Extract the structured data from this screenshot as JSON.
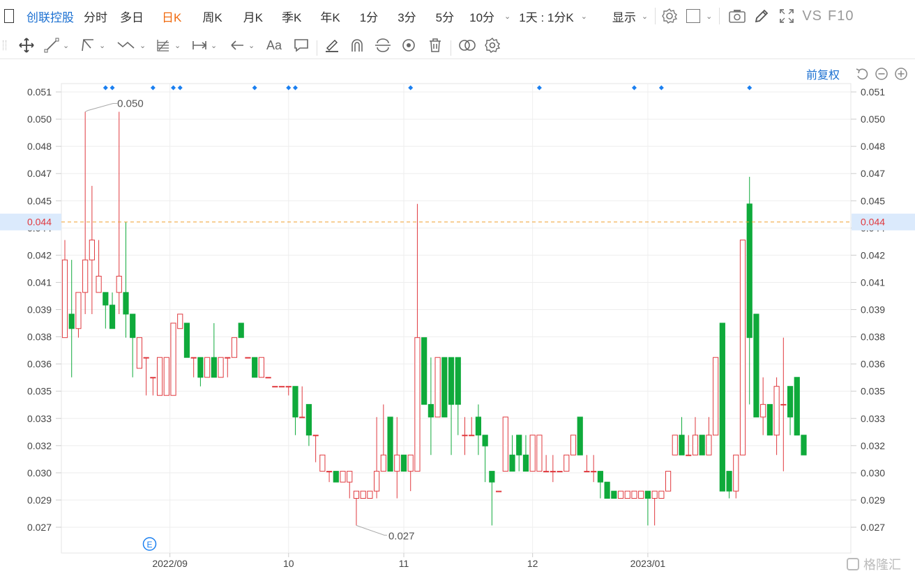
{
  "toolbar": {
    "stock_name": "创联控股",
    "tabs": [
      {
        "label": "分时",
        "active": false
      },
      {
        "label": "多日",
        "active": false
      },
      {
        "label": "日K",
        "active": true
      },
      {
        "label": "周K",
        "active": false
      },
      {
        "label": "月K",
        "active": false
      },
      {
        "label": "季K",
        "active": false
      },
      {
        "label": "年K",
        "active": false
      },
      {
        "label": "1分",
        "active": false
      },
      {
        "label": "3分",
        "active": false
      },
      {
        "label": "5分",
        "active": false
      },
      {
        "label": "10分",
        "active": false
      }
    ],
    "period_select": "1天 : 1分K",
    "display_label": "显示",
    "vs_label": "VS",
    "f10_label": "F10"
  },
  "chart_header": {
    "adjust_label": "前复权"
  },
  "watermark": "格隆汇",
  "colors": {
    "up": "#e0393e",
    "down": "#0faa3b",
    "accent": "#1a6fd1",
    "active_tab": "#f06a0f",
    "current_price_line": "#f0a030",
    "grid": "#eeeeee"
  },
  "chart_data": {
    "type": "candlestick",
    "y_ticks": [
      "0.051",
      "0.050",
      "0.048",
      "0.047",
      "0.045",
      "0.044",
      "0.042",
      "0.041",
      "0.039",
      "0.038",
      "0.036",
      "0.035",
      "0.033",
      "0.032",
      "0.030",
      "0.029",
      "0.027"
    ],
    "ylim": [
      0.0262,
      0.0519
    ],
    "x_labels": [
      {
        "label": "2022/09",
        "index": 15.5
      },
      {
        "label": "10",
        "index": 33
      },
      {
        "label": "11",
        "index": 50
      },
      {
        "label": "12",
        "index": 69
      },
      {
        "label": "2023/01",
        "index": 86
      }
    ],
    "current_price": "0.044",
    "current_value": 0.0441,
    "high_label": "0.050",
    "low_label": "0.027",
    "event_marker": "E",
    "event_index": 12.5,
    "diamond_indices": [
      6,
      7,
      13,
      16,
      17,
      28,
      33,
      34,
      51,
      70,
      84,
      88,
      101
    ],
    "candles": [
      [
        0.0377,
        0.042,
        0.0431,
        0.0377
      ],
      [
        0.039,
        0.0382,
        0.042,
        0.0355
      ],
      [
        0.0382,
        0.0402,
        0.0402,
        0.0377
      ],
      [
        0.0402,
        0.042,
        0.0502,
        0.039
      ],
      [
        0.042,
        0.0431,
        0.0461,
        0.039
      ],
      [
        0.0402,
        0.0411,
        0.0431,
        0.0402
      ],
      [
        0.0402,
        0.0395,
        0.0402,
        0.0382
      ],
      [
        0.0395,
        0.0382,
        0.0402,
        0.0382
      ],
      [
        0.0402,
        0.0411,
        0.0502,
        0.039
      ],
      [
        0.0402,
        0.039,
        0.0441,
        0.0377
      ],
      [
        0.039,
        0.0377,
        0.039,
        0.0355
      ],
      [
        0.036,
        0.0377,
        0.0377,
        0.036
      ],
      [
        0.0366,
        0.0366,
        0.0366,
        0.0345
      ],
      [
        0.0355,
        0.0355,
        0.0355,
        0.0345
      ],
      [
        0.0345,
        0.0366,
        0.0366,
        0.0345
      ],
      [
        0.0345,
        0.0366,
        0.0366,
        0.0345
      ],
      [
        0.0345,
        0.0385,
        0.0385,
        0.0345
      ],
      [
        0.0382,
        0.039,
        0.039,
        0.0382
      ],
      [
        0.0385,
        0.0366,
        0.0385,
        0.0366
      ],
      [
        0.0366,
        0.0366,
        0.0366,
        0.0355
      ],
      [
        0.0366,
        0.0355,
        0.0366,
        0.035
      ],
      [
        0.0355,
        0.0366,
        0.0366,
        0.0355
      ],
      [
        0.0366,
        0.0355,
        0.0385,
        0.0355
      ],
      [
        0.0355,
        0.0366,
        0.0366,
        0.0355
      ],
      [
        0.0366,
        0.0366,
        0.0366,
        0.0355
      ],
      [
        0.0366,
        0.0377,
        0.0377,
        0.0366
      ],
      [
        0.0385,
        0.0377,
        0.0385,
        0.0377
      ],
      [
        0.0366,
        0.0366,
        0.0366,
        0.0366
      ],
      [
        0.0366,
        0.0355,
        0.0366,
        0.0355
      ],
      [
        0.0355,
        0.0366,
        0.0366,
        0.0355
      ],
      [
        0.0355,
        0.0355,
        0.0355,
        0.0355
      ],
      [
        0.035,
        0.035,
        0.035,
        0.035
      ],
      [
        0.035,
        0.035,
        0.035,
        0.035
      ],
      [
        0.035,
        0.035,
        0.035,
        0.0345
      ],
      [
        0.035,
        0.0333,
        0.035,
        0.0323
      ],
      [
        0.0333,
        0.0333,
        0.035,
        0.0333
      ],
      [
        0.034,
        0.0323,
        0.034,
        0.0317
      ],
      [
        0.0323,
        0.0323,
        0.0323,
        0.0308
      ],
      [
        0.0303,
        0.0312,
        0.0312,
        0.0303
      ],
      [
        0.0303,
        0.0303,
        0.0303,
        0.0297
      ],
      [
        0.0303,
        0.0297,
        0.0303,
        0.0297
      ],
      [
        0.0297,
        0.0303,
        0.0303,
        0.0297
      ],
      [
        0.0297,
        0.0303,
        0.0303,
        0.0288
      ],
      [
        0.0288,
        0.0292,
        0.0292,
        0.0273
      ],
      [
        0.0288,
        0.0292,
        0.0292,
        0.0288
      ],
      [
        0.0288,
        0.0292,
        0.0292,
        0.0288
      ],
      [
        0.0292,
        0.0303,
        0.0333,
        0.0288
      ],
      [
        0.0303,
        0.0312,
        0.034,
        0.0303
      ],
      [
        0.0333,
        0.0303,
        0.0333,
        0.0303
      ],
      [
        0.0303,
        0.0312,
        0.0333,
        0.0288
      ],
      [
        0.0312,
        0.0303,
        0.0312,
        0.0303
      ],
      [
        0.0303,
        0.0312,
        0.0312,
        0.0292
      ],
      [
        0.0303,
        0.0377,
        0.0451,
        0.0303
      ],
      [
        0.0377,
        0.034,
        0.0377,
        0.034
      ],
      [
        0.034,
        0.0333,
        0.0366,
        0.0312
      ],
      [
        0.0333,
        0.0366,
        0.0366,
        0.0333
      ],
      [
        0.0366,
        0.0333,
        0.0366,
        0.0333
      ],
      [
        0.0366,
        0.034,
        0.0366,
        0.0312
      ],
      [
        0.0366,
        0.034,
        0.0366,
        0.0323
      ],
      [
        0.0323,
        0.0323,
        0.0333,
        0.0312
      ],
      [
        0.0323,
        0.0323,
        0.0333,
        0.0323
      ],
      [
        0.0333,
        0.0323,
        0.034,
        0.0312
      ],
      [
        0.0323,
        0.0317,
        0.0323,
        0.0297
      ],
      [
        0.0303,
        0.0297,
        0.0303,
        0.0273
      ],
      [
        0.0292,
        0.0292,
        0.0292,
        0.0292
      ],
      [
        0.0303,
        0.0333,
        0.0333,
        0.0303
      ],
      [
        0.0312,
        0.0303,
        0.0323,
        0.0303
      ],
      [
        0.0323,
        0.0312,
        0.0323,
        0.0303
      ],
      [
        0.0312,
        0.0303,
        0.0323,
        0.0303
      ],
      [
        0.0303,
        0.0323,
        0.0323,
        0.0303
      ],
      [
        0.0303,
        0.0323,
        0.0323,
        0.0303
      ],
      [
        0.0303,
        0.0303,
        0.0312,
        0.0303
      ],
      [
        0.0303,
        0.0303,
        0.0312,
        0.0297
      ],
      [
        0.0303,
        0.0303,
        0.0303,
        0.0303
      ],
      [
        0.0303,
        0.0312,
        0.0312,
        0.0303
      ],
      [
        0.0312,
        0.0323,
        0.0323,
        0.0312
      ],
      [
        0.0333,
        0.0312,
        0.0333,
        0.0312
      ],
      [
        0.0303,
        0.0303,
        0.0312,
        0.0303
      ],
      [
        0.0303,
        0.0303,
        0.0312,
        0.0297
      ],
      [
        0.0303,
        0.0297,
        0.0303,
        0.0288
      ],
      [
        0.0297,
        0.0288,
        0.0297,
        0.0288
      ],
      [
        0.0292,
        0.0288,
        0.0292,
        0.0288
      ],
      [
        0.0288,
        0.0292,
        0.0292,
        0.0288
      ],
      [
        0.0288,
        0.0292,
        0.0292,
        0.0288
      ],
      [
        0.0288,
        0.0292,
        0.0292,
        0.0288
      ],
      [
        0.0288,
        0.0292,
        0.0292,
        0.0288
      ],
      [
        0.0292,
        0.0288,
        0.0292,
        0.0273
      ],
      [
        0.0288,
        0.0292,
        0.0292,
        0.0273
      ],
      [
        0.0288,
        0.0292,
        0.0292,
        0.0288
      ],
      [
        0.0292,
        0.0303,
        0.0303,
        0.0292
      ],
      [
        0.0312,
        0.0323,
        0.0323,
        0.0312
      ],
      [
        0.0323,
        0.0312,
        0.0333,
        0.0312
      ],
      [
        0.0312,
        0.0312,
        0.0323,
        0.0312
      ],
      [
        0.0312,
        0.0323,
        0.0333,
        0.0312
      ],
      [
        0.0323,
        0.0312,
        0.0323,
        0.0312
      ],
      [
        0.0312,
        0.0323,
        0.0333,
        0.0312
      ],
      [
        0.0323,
        0.0366,
        0.0366,
        0.0323
      ],
      [
        0.0385,
        0.0292,
        0.0385,
        0.0292
      ],
      [
        0.0303,
        0.0292,
        0.0303,
        0.0288
      ],
      [
        0.0292,
        0.0312,
        0.0312,
        0.0288
      ],
      [
        0.0312,
        0.0431,
        0.0431,
        0.0312
      ],
      [
        0.0451,
        0.0377,
        0.0466,
        0.034
      ],
      [
        0.039,
        0.0333,
        0.039,
        0.0333
      ],
      [
        0.0333,
        0.034,
        0.0355,
        0.0323
      ],
      [
        0.034,
        0.0323,
        0.034,
        0.0323
      ],
      [
        0.0323,
        0.035,
        0.0355,
        0.0312
      ],
      [
        0.034,
        0.034,
        0.0377,
        0.0303
      ],
      [
        0.035,
        0.0333,
        0.035,
        0.0323
      ],
      [
        0.0355,
        0.0323,
        0.0355,
        0.0323
      ],
      [
        0.0323,
        0.0312,
        0.0323,
        0.0312
      ]
    ]
  }
}
